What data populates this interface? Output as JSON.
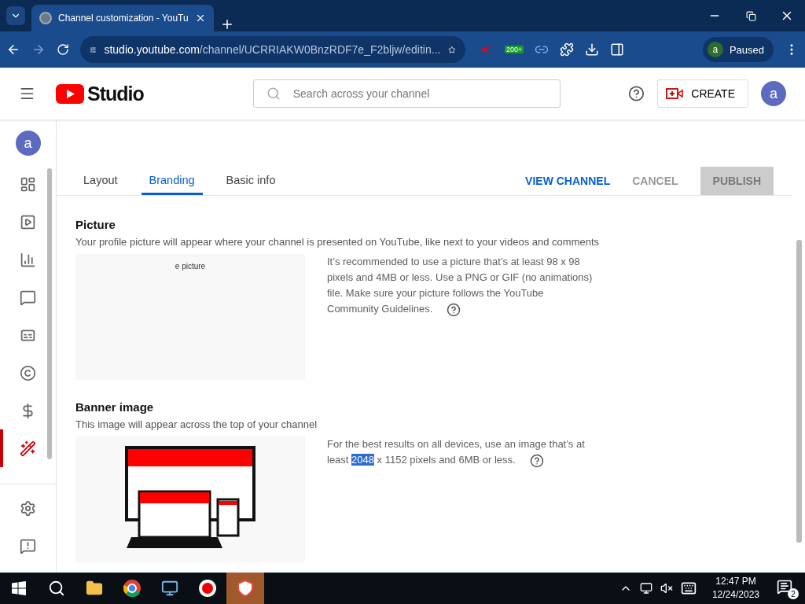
{
  "browser": {
    "tab_title": "Channel customization - YouTu",
    "url_host": "studio.youtube.com",
    "url_path": "/channel/UCRRIAKW0BnzRDF7e_F2bljw/editin...",
    "extension_badge": "200+",
    "profile_initial": "a",
    "profile_status": "Paused"
  },
  "header": {
    "logo_text": "Studio",
    "search": {
      "placeholder": "Search across your channel"
    },
    "create_label": "CREATE",
    "avatar_initial": "a"
  },
  "sidebar": {
    "avatar_initial": "a",
    "items": [
      {
        "selected": false
      },
      {
        "selected": false
      },
      {
        "selected": false
      },
      {
        "selected": false
      },
      {
        "selected": false
      },
      {
        "selected": false
      },
      {
        "selected": false
      },
      {
        "selected": true
      }
    ]
  },
  "tabs": [
    {
      "label": "Layout",
      "selected": false
    },
    {
      "label": "Branding",
      "selected": true
    },
    {
      "label": "Basic info",
      "selected": false
    }
  ],
  "actions": [
    {
      "label": "VIEW CHANNEL",
      "kind": "link",
      "disabled": false
    },
    {
      "label": "CANCEL",
      "kind": "link",
      "disabled": true
    },
    {
      "label": "PUBLISH",
      "kind": "filled",
      "disabled": true
    }
  ],
  "picture": {
    "title": "Picture",
    "description": "Your profile picture will appear where your channel is presented on YouTube, like next to your videos and comments",
    "preview_text": "e picture",
    "info": "It’s recommended to use a picture that’s at least 98 x 98 pixels and 4MB or less. Use a PNG or GIF (no animations) file. Make sure your picture follows the YouTube Community Guidelines."
  },
  "banner": {
    "title": "Banner image",
    "description": "This image will appear across the top of your channel",
    "info_before": "For the best results on all devices, use an image that’s at least ",
    "info_selected": "2048",
    "info_after": " x 1152 pixels and 6MB or less."
  },
  "taskbar": {
    "time": "12:47 PM",
    "date": "12/24/2023",
    "notification_count": "2"
  }
}
